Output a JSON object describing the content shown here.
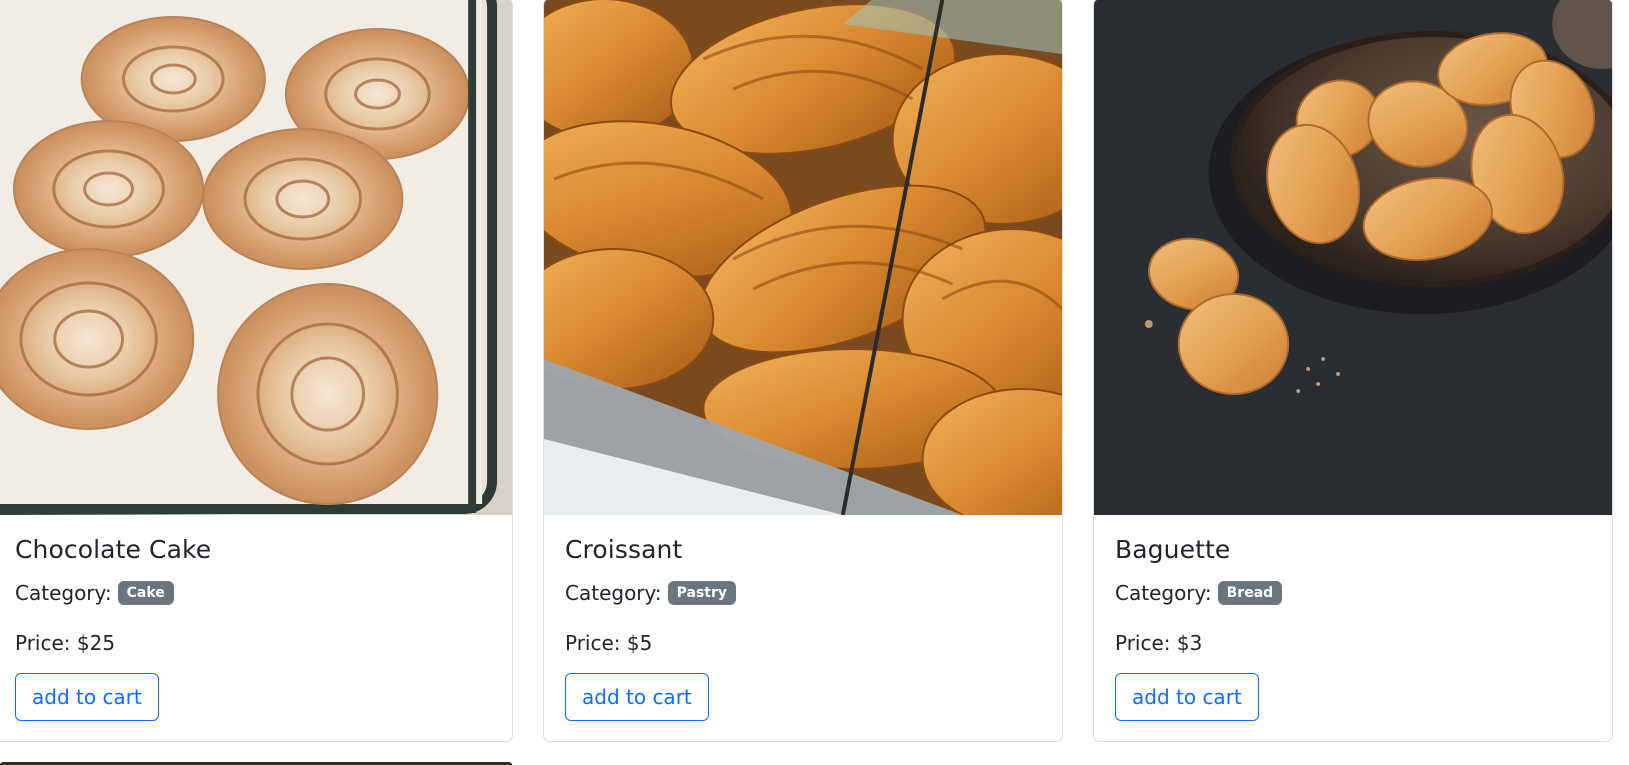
{
  "products": [
    {
      "name": "Chocolate Cake",
      "category_label": "Category:",
      "category": "Cake",
      "price": "Price: $25",
      "button_label": "add to cart",
      "image_alt": "cinnamon rolls in glass dish"
    },
    {
      "name": "Croissant",
      "category_label": "Category:",
      "category": "Pastry",
      "price": "Price: $5",
      "button_label": "add to cart",
      "image_alt": "croissants in display case"
    },
    {
      "name": "Baguette",
      "category_label": "Category:",
      "category": "Bread",
      "price": "Price: $3",
      "button_label": "add to cart",
      "image_alt": "madeleines on dark plate"
    }
  ],
  "colors": {
    "accent": "#0d6efd",
    "badge": "#6c757d",
    "text": "#212529",
    "border": "#dcdfe3"
  }
}
